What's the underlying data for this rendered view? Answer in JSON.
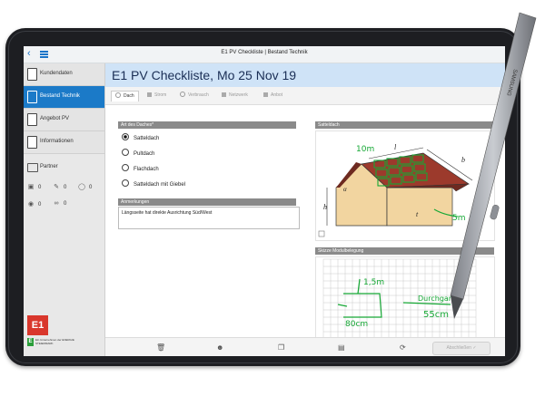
{
  "app": {
    "title": "E1 PV Checkliste | Bestand Technik"
  },
  "sidebar": {
    "items": [
      {
        "label": "Kundendaten"
      },
      {
        "label": "Bestand Technik"
      },
      {
        "label": "Angebot PV"
      },
      {
        "label": "Informationen"
      }
    ],
    "partner_label": "Partner",
    "counts": [
      {
        "icon": "camera-icon",
        "value": "0"
      },
      {
        "icon": "pen-icon",
        "value": "0"
      },
      {
        "icon": "microphone-icon",
        "value": "0"
      },
      {
        "icon": "location-icon",
        "value": "0"
      },
      {
        "icon": "paperclip-icon",
        "value": "0"
      }
    ]
  },
  "brand": {
    "logo": "E1",
    "small_logo": "E",
    "tagline": "Ein Unternehmen der ENERGIE STEIERMARK"
  },
  "header": {
    "title": "E1 PV Checkliste,  Mo 25 Nov 19"
  },
  "tabs": [
    {
      "label": "Dach"
    },
    {
      "label": "Strom"
    },
    {
      "label": "Verbrauch"
    },
    {
      "label": "Netzwerk"
    },
    {
      "label": "Anbot"
    }
  ],
  "roof": {
    "section_label": "Art des Daches*",
    "options": [
      {
        "label": "Satteldach",
        "selected": true
      },
      {
        "label": "Pultdach",
        "selected": false
      },
      {
        "label": "Flachdach",
        "selected": false
      },
      {
        "label": "Satteldach mit Giebel",
        "selected": false
      }
    ]
  },
  "notes": {
    "label": "Anmerkungen",
    "value": "Längsseite hat direkte Ausrichtung Süd/West"
  },
  "sketch_roof": {
    "label": "Satteldach",
    "dims": {
      "h": "h",
      "alpha": "α",
      "l": "l",
      "b": "b",
      "t": "t"
    },
    "handwriting": [
      "10m",
      "5m"
    ]
  },
  "sketch_modules": {
    "label": "Skizze Modulbelegung",
    "handwriting": [
      "1,5m",
      "Durchgang",
      "80cm",
      "55cm"
    ]
  },
  "footer": {
    "icons": [
      "trash-icon",
      "people-icon",
      "copy-icon",
      "document-icon",
      "refresh-icon"
    ],
    "finish_label": "Abschließen"
  },
  "device": {
    "brand": "SAMSUNG"
  },
  "colors": {
    "accent": "#1b7ac8",
    "header_bg": "#cfe3f7",
    "ink": "#16a835",
    "roof": "#9c3a2c",
    "wall": "#f2d5a0"
  }
}
